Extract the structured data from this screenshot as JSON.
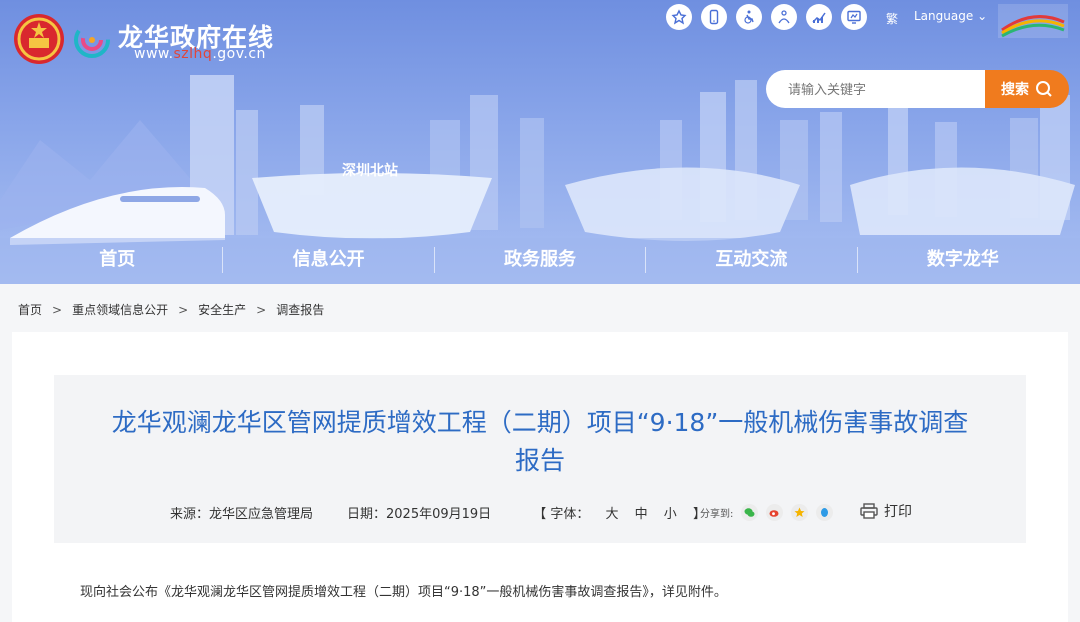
{
  "header": {
    "site_title": "龙华政府在线",
    "site_url_prefix": "www.",
    "site_url_highlight": "szlhq",
    "site_url_suffix": ".gov.cn",
    "tool_icons": [
      "starred-gov-icon",
      "mobile-icon",
      "accessibility-icon",
      "elderly-mode-icon",
      "statistics-icon",
      "screen-icon"
    ],
    "trad_label": "繁",
    "language_label": "Language",
    "search_placeholder": "请输入关键字",
    "search_label": "搜索",
    "station_label": "深圳北站",
    "accent_color": "#f07b1e"
  },
  "nav": {
    "items": [
      "首页",
      "信息公开",
      "政务服务",
      "互动交流",
      "数字龙华"
    ]
  },
  "breadcrumb": {
    "items": [
      "首页",
      "重点领域信息公开",
      "安全生产",
      "调查报告"
    ],
    "separator": ">"
  },
  "article": {
    "title_line1": "龙华观澜龙华区管网提质增效工程（二期）项目“9·18”一般机械伤害事故调查",
    "title_line2": "报告",
    "source": "来源：龙华区应急管理局",
    "date": "日期：2025年09月19日",
    "font_open": "【 字体：",
    "font_large": "大",
    "font_medium": "中",
    "font_small": "小",
    "font_close": "】",
    "share_label": "分享到:",
    "print_label": "打印",
    "body": "现向社会公布《龙华观澜龙华区管网提质增效工程（二期）项目“9·18”一般机械伤害事故调查报告》，详见附件。",
    "title_color": "#2d6bc4"
  }
}
